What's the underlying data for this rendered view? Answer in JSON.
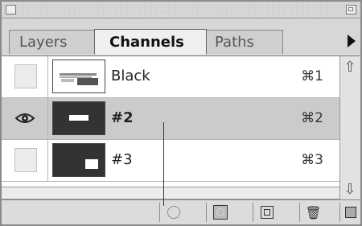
{
  "tabs": [
    {
      "label": "Layers",
      "active": false
    },
    {
      "label": "Channels",
      "active": true
    },
    {
      "label": "Paths",
      "active": false
    }
  ],
  "channels": [
    {
      "name": "Black",
      "shortcut": "⌘1",
      "visible": false,
      "selected": false
    },
    {
      "name": "#2",
      "shortcut": "⌘2",
      "visible": true,
      "selected": true
    },
    {
      "name": "#3",
      "shortcut": "⌘3",
      "visible": false,
      "selected": false
    }
  ],
  "icons": {
    "panel_menu": "triangle-right-icon",
    "scroll_up": "arrow-up-icon",
    "scroll_down": "arrow-down-icon",
    "eye": "eye-icon",
    "load_selection": "dotted-circle-icon",
    "save_selection": "save-selection-icon",
    "new_channel": "new-channel-icon",
    "delete_channel": "trash-icon"
  },
  "colors": {
    "panel_bg": "#ededed",
    "selected_row": "#cbcbcb",
    "list_bg": "#ffffff"
  }
}
